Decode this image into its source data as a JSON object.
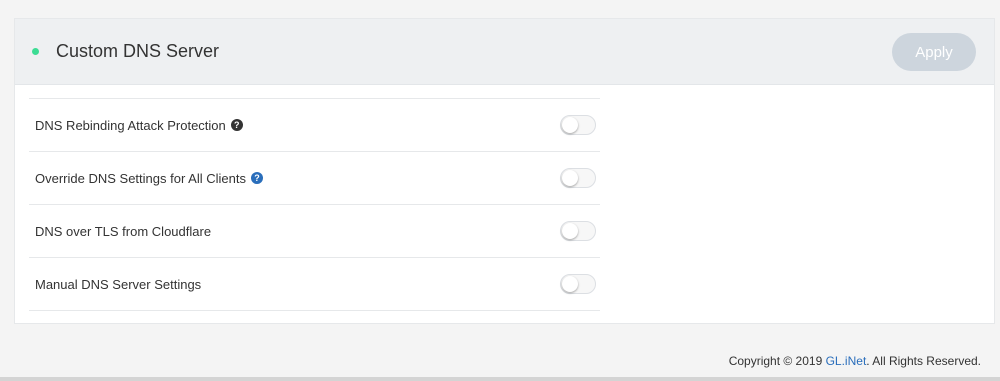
{
  "panel": {
    "title": "Custom DNS Server",
    "status_color": "#3cdc94",
    "apply_label": "Apply"
  },
  "settings": [
    {
      "label": "DNS Rebinding Attack Protection",
      "help": true,
      "help_icon": "question-circle-icon",
      "enabled": false
    },
    {
      "label": "Override DNS Settings for All Clients",
      "help": true,
      "help_icon": "question-circle-icon",
      "enabled": false
    },
    {
      "label": "DNS over TLS from Cloudflare",
      "help": false,
      "enabled": false
    },
    {
      "label": "Manual DNS Server Settings",
      "help": false,
      "enabled": false
    }
  ],
  "footer": {
    "prefix": "Copyright © 2019 ",
    "link_text": "GL.iNet",
    "suffix": ". All Rights Reserved."
  },
  "colors": {
    "accent": "#2a6ebb",
    "apply_disabled": "#cdd5dd",
    "header_bg": "#eef0f2"
  }
}
